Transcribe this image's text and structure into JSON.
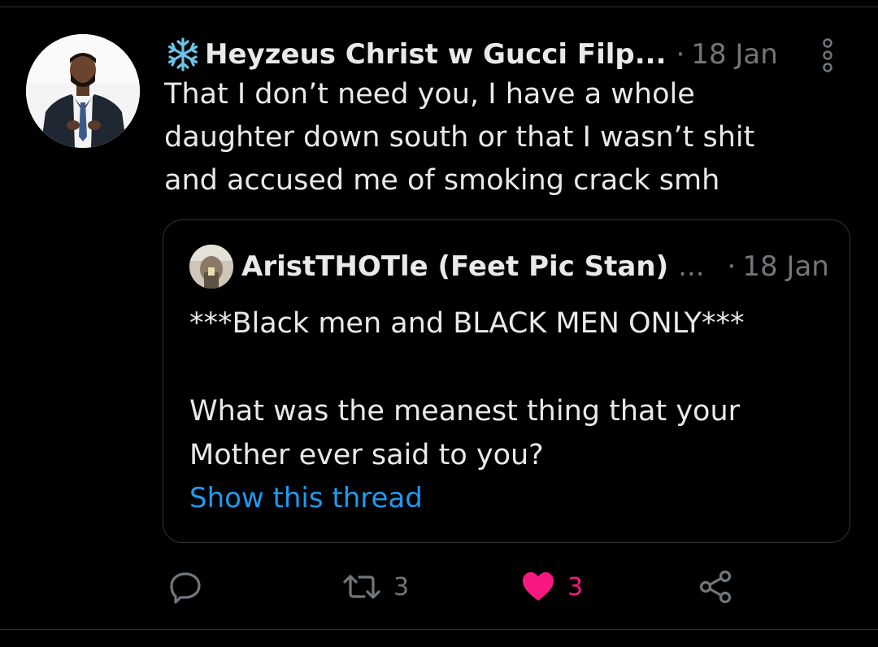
{
  "tweet": {
    "display_name": "Heyzeus Christ w Gucci Filp...",
    "separator": "·",
    "date": "18 Jan",
    "text": "That I don’t need you, I have a whole daughter down south or that I wasn’t shit and accused me of smoking crack smh"
  },
  "quote": {
    "display_name": "AristTHOTle (Feet Pic Stan)",
    "truncation": "...",
    "separator": "·",
    "date": "18 Jan",
    "text_line1": "***Black men and BLACK MEN ONLY***",
    "text_line2": "What was the meanest thing that your Mother ever said to you?",
    "show_thread_label": "Show this thread"
  },
  "actions": {
    "reply_count": "",
    "retweet_count": "3",
    "like_count": "3"
  },
  "icons": {
    "name_prefix": "snowflake-icon",
    "more": "more-vertical-icon",
    "reply": "reply-icon",
    "retweet": "retweet-icon",
    "like": "heart-icon",
    "share": "share-icon"
  },
  "colors": {
    "background": "#000000",
    "text": "#e7e9ea",
    "muted": "#71767b",
    "link": "#1d9bf0",
    "like": "#f91880",
    "border": "#2f3336"
  }
}
